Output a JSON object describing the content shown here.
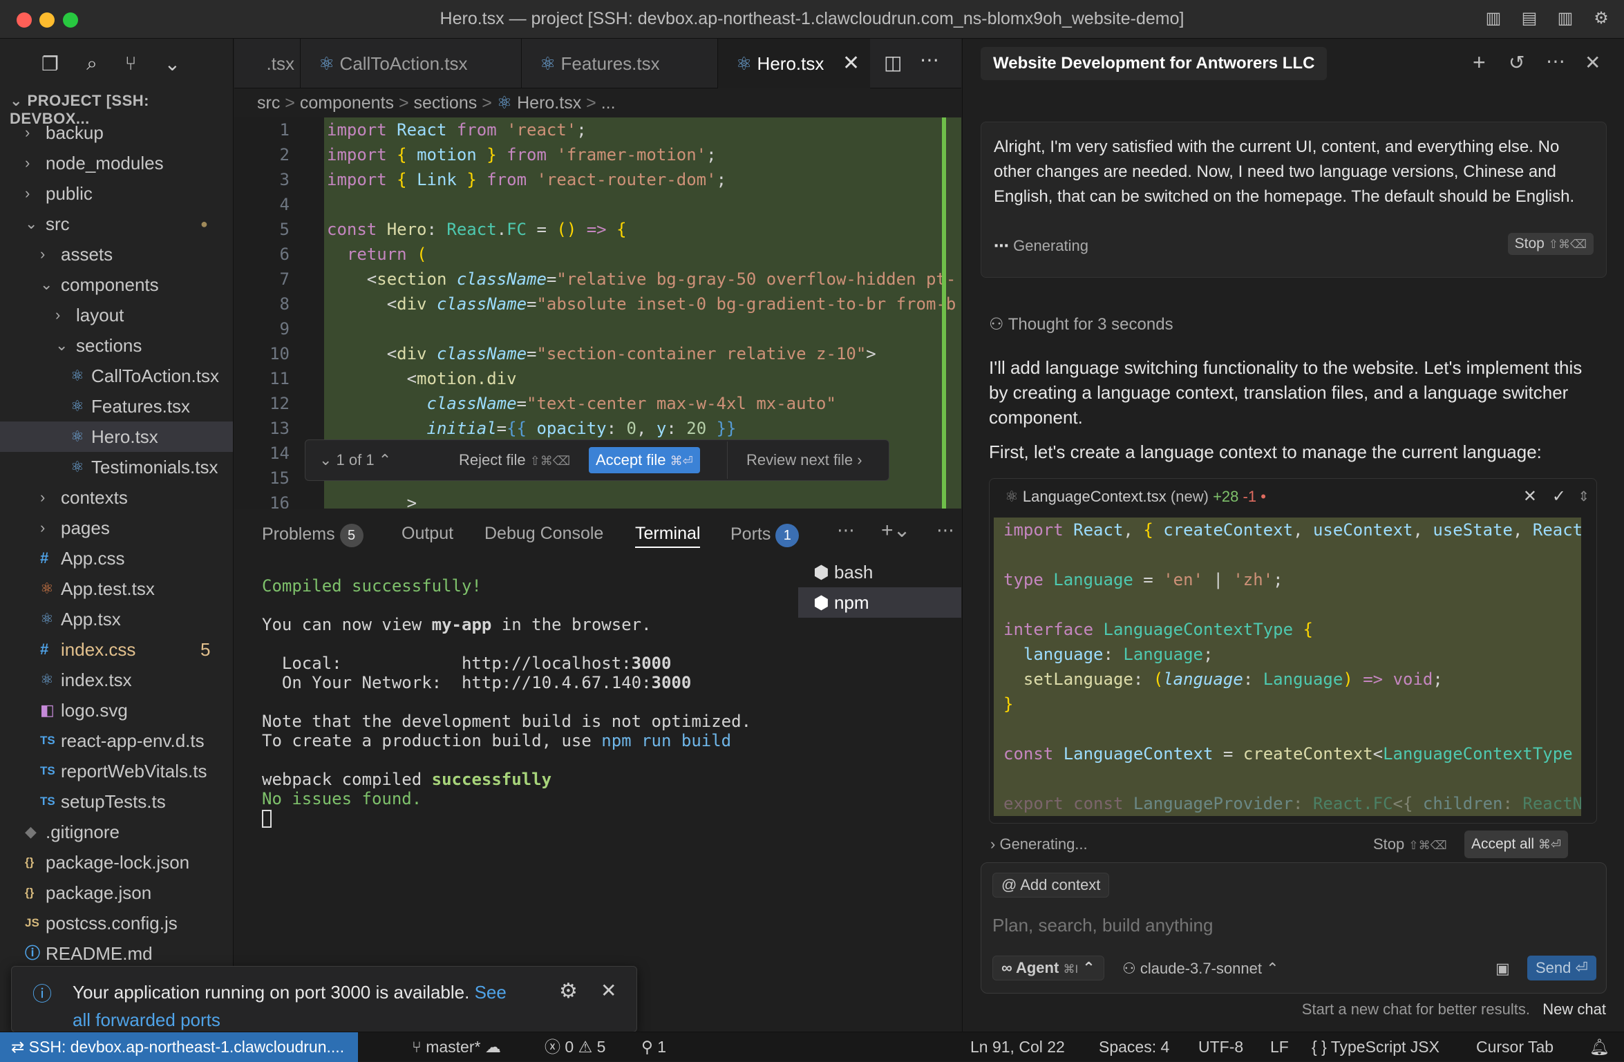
{
  "window": {
    "title": "Hero.tsx — project [SSH: devbox.ap-northeast-1.clawcloudrun.com_ns-blomx9oh_website-demo]",
    "traffic": {
      "close": "#ff5f57",
      "minimize": "#febc2e",
      "maximize": "#28c840"
    }
  },
  "sidebar": {
    "header": "PROJECT [SSH: DEVBOX...",
    "items": [
      {
        "label": "backup",
        "kind": "folder",
        "depth": 0,
        "open": false
      },
      {
        "label": "node_modules",
        "kind": "folder",
        "depth": 0,
        "open": false
      },
      {
        "label": "public",
        "kind": "folder",
        "depth": 0,
        "open": false
      },
      {
        "label": "src",
        "kind": "folder",
        "depth": 0,
        "open": true
      },
      {
        "label": "assets",
        "kind": "folder",
        "depth": 1,
        "open": false
      },
      {
        "label": "components",
        "kind": "folder",
        "depth": 1,
        "open": true
      },
      {
        "label": "layout",
        "kind": "folder",
        "depth": 2,
        "open": false
      },
      {
        "label": "sections",
        "kind": "folder",
        "depth": 2,
        "open": true
      },
      {
        "label": "CallToAction.tsx",
        "kind": "react",
        "depth": 3
      },
      {
        "label": "Features.tsx",
        "kind": "react",
        "depth": 3
      },
      {
        "label": "Hero.tsx",
        "kind": "react",
        "depth": 3,
        "selected": true
      },
      {
        "label": "Testimonials.tsx",
        "kind": "react",
        "depth": 3
      },
      {
        "label": "contexts",
        "kind": "folder",
        "depth": 1,
        "open": false
      },
      {
        "label": "pages",
        "kind": "folder",
        "depth": 1,
        "open": false
      },
      {
        "label": "App.css",
        "kind": "css",
        "depth": 1
      },
      {
        "label": "App.test.tsx",
        "kind": "test",
        "depth": 1
      },
      {
        "label": "App.tsx",
        "kind": "react",
        "depth": 1
      },
      {
        "label": "index.css",
        "kind": "css",
        "depth": 1,
        "badge": "5",
        "modified": true
      },
      {
        "label": "index.tsx",
        "kind": "react",
        "depth": 1
      },
      {
        "label": "logo.svg",
        "kind": "svg",
        "depth": 1
      },
      {
        "label": "react-app-env.d.ts",
        "kind": "ts",
        "depth": 1
      },
      {
        "label": "reportWebVitals.ts",
        "kind": "ts",
        "depth": 1
      },
      {
        "label": "setupTests.ts",
        "kind": "ts",
        "depth": 1
      },
      {
        "label": ".gitignore",
        "kind": "git",
        "depth": 0
      },
      {
        "label": "package-lock.json",
        "kind": "json",
        "depth": 0
      },
      {
        "label": "package.json",
        "kind": "json",
        "depth": 0
      },
      {
        "label": "postcss.config.js",
        "kind": "js",
        "depth": 0
      },
      {
        "label": "README.md",
        "kind": "info",
        "depth": 0
      }
    ]
  },
  "tabs": [
    {
      "label": ".tsx",
      "active": false
    },
    {
      "label": "CallToAction.tsx",
      "active": false
    },
    {
      "label": "Features.tsx",
      "active": false
    },
    {
      "label": "Hero.tsx",
      "active": true
    }
  ],
  "breadcrumb": [
    "src",
    ">",
    "components",
    ">",
    "sections",
    ">",
    "Hero.tsx",
    ">",
    "..."
  ],
  "code": {
    "line_numbers": [
      "1",
      "2",
      "3",
      "4",
      "5",
      "6",
      "7",
      "8",
      "9",
      "10",
      "11",
      "12",
      "13",
      "14",
      "15",
      "16"
    ]
  },
  "diffbar": {
    "counter": "1 of 1",
    "reject": "Reject file",
    "reject_kbd": "⇧⌘⌫",
    "accept": "Accept file",
    "accept_kbd": "⌘⏎",
    "review": "Review next file"
  },
  "panel": {
    "tabs": [
      {
        "label": "Problems",
        "badge": "5"
      },
      {
        "label": "Output"
      },
      {
        "label": "Debug Console"
      },
      {
        "label": "Terminal",
        "active": true
      },
      {
        "label": "Ports",
        "badge": "1"
      }
    ],
    "terminals": [
      "bash",
      "npm"
    ]
  },
  "terminal": {
    "l1": "Compiled successfully!",
    "l2a": "You can now view ",
    "l2b": "my-app",
    "l2c": " in the browser.",
    "l3a": "  Local:            http://localhost:",
    "l3b": "3000",
    "l4a": "  On Your Network:  http://10.4.67.140:",
    "l4b": "3000",
    "l5": "Note that the development build is not optimized.",
    "l6a": "To create a production build, use ",
    "l6b": "npm run build",
    ".": ".",
    "l7a": "webpack compiled ",
    "l7b": "successfully",
    "l8": "No issues found."
  },
  "chat": {
    "title": "Website Development for Antworers LLC",
    "user_message": "Alright, I'm very satisfied with the current UI, content, and everything else. No other changes are needed. Now, I need two language versions, Chinese and English, that can be switched on the homepage. The default should be English.",
    "generating": "Generating",
    "stop": "Stop",
    "stop_kbd": "⇧⌘⌫",
    "thought": "Thought for 3 seconds",
    "reply1": "I'll add language switching functionality to the website. Let's implement this by creating a language context, translation files, and a language switcher component.",
    "reply2": "First, let's create a language context to manage the current language:",
    "file_name": "LanguageContext.tsx",
    "file_tag": "(new)",
    "file_added": "+28",
    "file_removed": "-1",
    "generating2": "Generating...",
    "stop2": "Stop",
    "stop2_kbd": "⇧⌘⌫",
    "accept_all": "Accept all",
    "accept_all_kbd": "⌘⏎",
    "add_context": "Add context",
    "placeholder": "Plan, search, build anything",
    "agent": "Agent",
    "agent_kbd": "⌘I",
    "model": "claude-3.7-sonnet",
    "send": "Send",
    "footer": "Start a new chat for better results.",
    "new_chat": "New chat"
  },
  "toast": {
    "text": "Your application running on port 3000 is available.",
    "link1": "See",
    "link2": "all forwarded ports"
  },
  "status": {
    "remote": "SSH: devbox.ap-northeast-1.clawcloudrun....",
    "branch": "master*",
    "errors": "0",
    "warnings": "5",
    "ports": "1",
    "position": "Ln 91, Col 22",
    "spaces": "Spaces: 4",
    "encoding": "UTF-8",
    "eol": "LF",
    "language": "TypeScript JSX",
    "cursor_tab": "Cursor Tab"
  }
}
